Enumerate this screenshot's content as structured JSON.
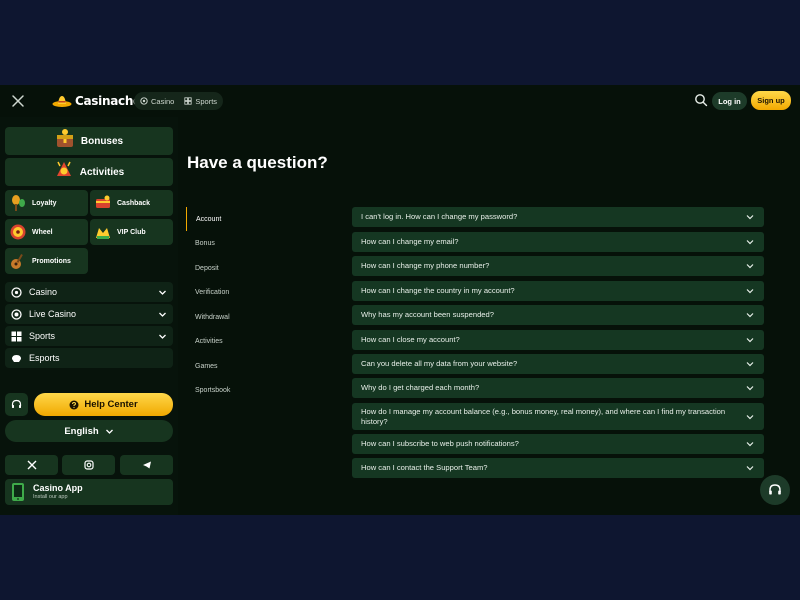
{
  "header": {
    "brand": "Casinacho",
    "nav": [
      {
        "label": "Casino",
        "icon": "casino-chip-icon"
      },
      {
        "label": "Sports",
        "icon": "sports-icon"
      }
    ],
    "login_label": "Log in",
    "signup_label": "Sign up"
  },
  "sidebar": {
    "promo_cards": [
      {
        "label": "Bonuses",
        "icon": "treasure-chest-icon"
      },
      {
        "label": "Activities",
        "icon": "activities-icon"
      }
    ],
    "small_cards": [
      {
        "label": "Loyalty",
        "icon": "maracas-icon"
      },
      {
        "label": "Cashback",
        "icon": "cashback-icon"
      },
      {
        "label": "Wheel",
        "icon": "wheel-icon"
      },
      {
        "label": "VIP Club",
        "icon": "vip-icon"
      },
      {
        "label": "Promotions",
        "icon": "guitar-icon"
      }
    ],
    "menu": [
      {
        "label": "Casino",
        "icon": "casino-chip-icon",
        "expandable": true
      },
      {
        "label": "Live Casino",
        "icon": "live-casino-icon",
        "expandable": true
      },
      {
        "label": "Sports",
        "icon": "sports-icon",
        "expandable": true
      },
      {
        "label": "Esports",
        "icon": "esports-icon",
        "expandable": false
      }
    ],
    "help_label": "Help Center",
    "language": "English",
    "socials": [
      "x-icon",
      "instagram-icon",
      "telegram-icon"
    ],
    "app_title": "Casino App",
    "app_sub": "Install our app"
  },
  "main": {
    "title": "Have a question?",
    "categories": [
      "Account",
      "Bonus",
      "Deposit",
      "Verification",
      "Withdrawal",
      "Activities",
      "Games",
      "Sportsbook"
    ],
    "active_category": "Account",
    "faq": [
      "I can't log in. How can I change my password?",
      "How can I change my email?",
      "How can I change my phone number?",
      "How can I change the country in my account?",
      "Why has my account been suspended?",
      "How can I close my account?",
      "Can you delete all my data from your website?",
      "Why do I get charged each month?",
      "How do I manage my account balance (e.g., bonus money, real money), and where can I find my transaction history?",
      "How can I subscribe to web push notifications?",
      "How can I contact the Support Team?"
    ]
  },
  "colors": {
    "accent": "#f2a900",
    "background": "#061109",
    "card": "#17351f",
    "faq_card": "#153722",
    "page_backdrop": "#0e1630"
  }
}
